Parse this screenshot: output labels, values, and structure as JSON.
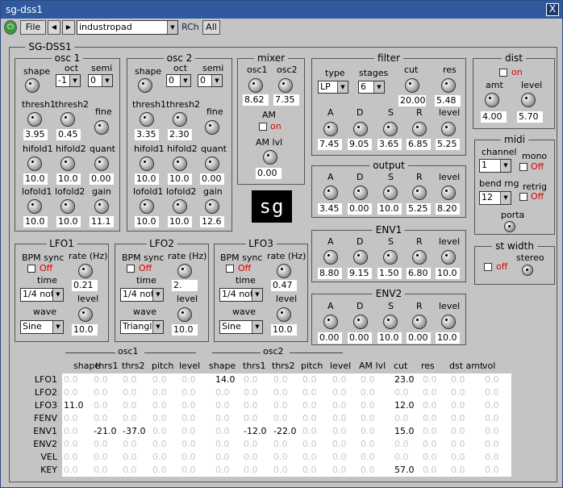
{
  "window": {
    "title": "sg-dss1",
    "close": "X"
  },
  "toolbar": {
    "file": "File",
    "prev": "◀",
    "next": "▶",
    "preset": "industropad",
    "rch": "RCh",
    "all": "All"
  },
  "panel_title": "SG-DSS1",
  "osc1": {
    "title": "osc 1",
    "shape": "shape",
    "oct": "oct",
    "oct_val": "-1",
    "semi": "semi",
    "semi_val": "0",
    "thresh1": "thresh1",
    "thresh2": "thresh2",
    "fine": "fine",
    "thresh1_val": "3.95",
    "thresh2_val": "0.45",
    "hifold1": "hifold1",
    "hifold2": "hifold2",
    "quant": "quant",
    "hifold1_val": "10.0",
    "hifold2_val": "10.0",
    "quant_val": "0.00",
    "lofold1": "lofold1",
    "lofold2": "lofold2",
    "gain": "gain",
    "lofold1_val": "10.0",
    "lofold2_val": "10.0",
    "gain_val": "11.1"
  },
  "osc2": {
    "title": "osc 2",
    "shape": "shape",
    "oct": "oct",
    "oct_val": "0",
    "semi": "semi",
    "semi_val": "0",
    "thresh1": "thresh1",
    "thresh2": "thresh2",
    "fine": "fine",
    "thresh1_val": "3.35",
    "thresh2_val": "2.30",
    "hifold1": "hifold1",
    "hifold2": "hifold2",
    "quant": "quant",
    "hifold1_val": "10.0",
    "hifold2_val": "10.0",
    "quant_val": "0.00",
    "lofold1": "lofold1",
    "lofold2": "lofold2",
    "gain": "gain",
    "lofold1_val": "10.0",
    "lofold2_val": "10.0",
    "gain_val": "12.6"
  },
  "mixer": {
    "title": "mixer",
    "osc1": "osc1",
    "osc2": "osc2",
    "osc1_val": "8.62",
    "osc2_val": "7.35",
    "am": "AM",
    "am_on": "on",
    "amlvl": "AM lvl",
    "amlvl_val": "0.00"
  },
  "filter": {
    "title": "filter",
    "type": "type",
    "type_val": "LP",
    "stages": "stages",
    "stages_val": "6",
    "cut": "cut",
    "cut_val": "20.00",
    "res": "res",
    "res_val": "5.48",
    "a": "A",
    "d": "D",
    "s": "S",
    "r": "R",
    "level": "level",
    "a_val": "7.45",
    "d_val": "9.05",
    "s_val": "3.65",
    "r_val": "6.85",
    "level_val": "5.25"
  },
  "output": {
    "title": "output",
    "a": "A",
    "d": "D",
    "s": "S",
    "r": "R",
    "level": "level",
    "a_val": "3.45",
    "d_val": "0.00",
    "s_val": "10.0",
    "r_val": "5.25",
    "level_val": "8.20"
  },
  "env1": {
    "title": "ENV1",
    "a": "A",
    "d": "D",
    "s": "S",
    "r": "R",
    "level": "level",
    "a_val": "8.80",
    "d_val": "9.15",
    "s_val": "1.50",
    "r_val": "6.80",
    "level_val": "10.0"
  },
  "env2": {
    "title": "ENV2",
    "a": "A",
    "d": "D",
    "s": "S",
    "r": "R",
    "level": "level",
    "a_val": "0.00",
    "d_val": "0.00",
    "s_val": "10.0",
    "r_val": "0.00",
    "level_val": "10.0"
  },
  "dist": {
    "title": "dist",
    "on": "on",
    "amt": "amt",
    "level": "level",
    "amt_val": "4.00",
    "level_val": "5.70"
  },
  "midi": {
    "title": "midi",
    "channel": "channel",
    "channel_val": "1",
    "mono": "mono",
    "mono_off": "Off",
    "bend": "bend rng",
    "bend_val": "12",
    "retrig": "retrig",
    "retrig_off": "Off",
    "porta": "porta"
  },
  "stwidth": {
    "title": "st width",
    "off": "off",
    "stereo": "stereo"
  },
  "lfo1": {
    "title": "LFO1",
    "bpm": "BPM sync",
    "off": "Off",
    "rate": "rate (Hz)",
    "rate_val": "0.21",
    "time": "time",
    "time_val": "1/4 not",
    "level": "level",
    "level_val": "10.0",
    "wave": "wave",
    "wave_val": "Sine"
  },
  "lfo2": {
    "title": "LFO2",
    "bpm": "BPM sync",
    "off": "Off",
    "rate": "rate (Hz)",
    "rate_val": "2.",
    "time": "time",
    "time_val": "1/4 not",
    "level": "level",
    "level_val": "10.0",
    "wave": "wave",
    "wave_val": "Triangl"
  },
  "lfo3": {
    "title": "LFO3",
    "bpm": "BPM sync",
    "off": "Off",
    "rate": "rate (Hz)",
    "rate_val": "0.47",
    "time": "time",
    "time_val": "1/4 not",
    "level": "level",
    "level_val": "10.0",
    "wave": "wave",
    "wave_val": "Sine"
  },
  "matrix": {
    "group_osc1": "osc1",
    "group_osc2": "osc2",
    "columns": [
      "shape",
      "thrs1",
      "thrs2",
      "pitch",
      "level",
      "shape",
      "thrs1",
      "thrs2",
      "pitch",
      "level",
      "AM lvl",
      "cut",
      "res",
      "dst amt",
      "vol"
    ],
    "rows": [
      {
        "label": "LFO1",
        "values": [
          "0.0",
          "0.0",
          "0.0",
          "0.0",
          "0.0",
          "14.0",
          "0.0",
          "0.0",
          "0.0",
          "0.0",
          "0.0",
          "23.0",
          "0.0",
          "0.0",
          "0.0"
        ]
      },
      {
        "label": "LFO2",
        "values": [
          "0.0",
          "0.0",
          "0.0",
          "0.0",
          "0.0",
          "0.0",
          "0.0",
          "0.0",
          "0.0",
          "0.0",
          "0.0",
          "0.0",
          "0.0",
          "0.0",
          "0.0"
        ]
      },
      {
        "label": "LFO3",
        "values": [
          "11.0",
          "0.0",
          "0.0",
          "0.0",
          "0.0",
          "0.0",
          "0.0",
          "0.0",
          "0.0",
          "0.0",
          "0.0",
          "12.0",
          "0.0",
          "0.0",
          "0.0"
        ]
      },
      {
        "label": "FENV",
        "values": [
          "0.0",
          "0.0",
          "0.0",
          "0.0",
          "0.0",
          "0.0",
          "0.0",
          "0.0",
          "0.0",
          "0.0",
          "0.0",
          "0.0",
          "0.0",
          "0.0",
          "0.0"
        ]
      },
      {
        "label": "ENV1",
        "values": [
          "0.0",
          "-21.0",
          "-37.0",
          "0.0",
          "0.0",
          "0.0",
          "-12.0",
          "-22.0",
          "0.0",
          "0.0",
          "0.0",
          "15.0",
          "0.0",
          "0.0",
          "0.0"
        ]
      },
      {
        "label": "ENV2",
        "values": [
          "0.0",
          "0.0",
          "0.0",
          "0.0",
          "0.0",
          "0.0",
          "0.0",
          "0.0",
          "0.0",
          "0.0",
          "0.0",
          "0.0",
          "0.0",
          "0.0",
          "0.0"
        ]
      },
      {
        "label": "VEL",
        "values": [
          "0.0",
          "0.0",
          "0.0",
          "0.0",
          "0.0",
          "0.0",
          "0.0",
          "0.0",
          "0.0",
          "0.0",
          "0.0",
          "0.0",
          "0.0",
          "0.0",
          "0.0"
        ]
      },
      {
        "label": "KEY",
        "values": [
          "0.0",
          "0.0",
          "0.0",
          "0.0",
          "0.0",
          "0.0",
          "0.0",
          "0.0",
          "0.0",
          "0.0",
          "0.0",
          "57.0",
          "0.0",
          "0.0",
          "0.0"
        ]
      }
    ]
  },
  "logo": "sg",
  "colors": {
    "title_bar": "#2f5aa0",
    "panel": "#c4c4c4",
    "off_red": "#dd0000",
    "inactive_matrix": "#c8c8c8"
  }
}
